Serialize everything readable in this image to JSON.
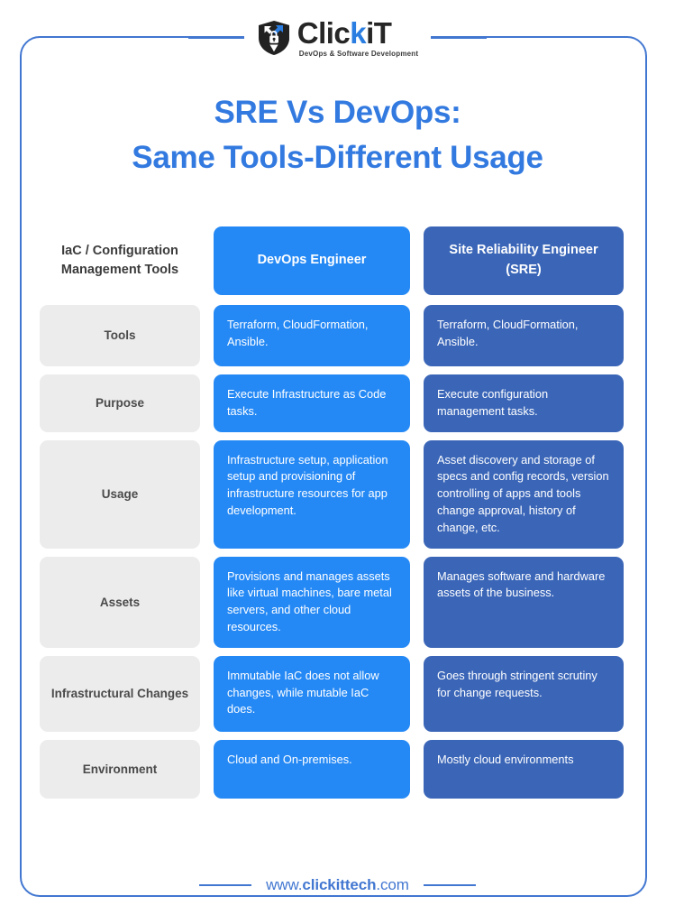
{
  "brand": {
    "logo_icon": "clickit-shield-lock-icon",
    "name_prefix": "Clic",
    "name_accent": "k",
    "name_suffix": "iT",
    "tagline": "DevOps & Software Development"
  },
  "title": {
    "line1": "SRE Vs DevOps:",
    "line2": "Same Tools-Different Usage",
    "color": "#337ae0"
  },
  "table": {
    "headers": {
      "label": "IaC / Configuration Management Tools",
      "devops": "DevOps Engineer",
      "sre": "Site Reliability Engineer (SRE)"
    },
    "colors": {
      "devops_bg": "#2589f5",
      "sre_bg": "#3b66b8",
      "label_bg": "#ececec",
      "label_text": "#4a4a4a"
    },
    "rows": [
      {
        "label": "Tools",
        "devops": "Terraform, CloudFormation, Ansible.",
        "sre": "Terraform, CloudFormation, Ansible."
      },
      {
        "label": "Purpose",
        "devops": "Execute Infrastructure as Code tasks.",
        "sre": "Execute configuration management tasks."
      },
      {
        "label": "Usage",
        "devops": "Infrastructure setup, application setup and provisioning of infrastructure resources for app development.",
        "sre": "Asset discovery and storage of specs and config records, version controlling of apps and tools change approval, history of change, etc."
      },
      {
        "label": "Assets",
        "devops": "Provisions and manages assets like virtual machines, bare metal servers, and other cloud resources.",
        "sre": "Manages software and hardware assets of the business."
      },
      {
        "label": "Infrastructural Changes",
        "devops": "Immutable IaC does not allow changes, while mutable IaC does.",
        "sre": "Goes through stringent scrutiny for change requests."
      },
      {
        "label": "Environment",
        "devops": "Cloud and On-premises.",
        "sre": "Mostly cloud environments"
      }
    ]
  },
  "footer": {
    "prefix": "www.",
    "domain": "clickittech",
    "suffix": ".com"
  }
}
